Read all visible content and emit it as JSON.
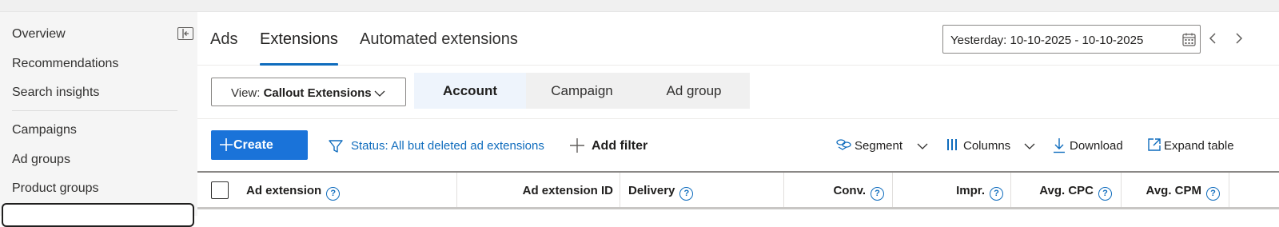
{
  "sidebar": {
    "items": [
      {
        "label": "Overview"
      },
      {
        "label": "Recommendations"
      },
      {
        "label": "Search insights"
      },
      {
        "label": "Campaigns"
      },
      {
        "label": "Ad groups"
      },
      {
        "label": "Product groups"
      }
    ],
    "collapse_icon": "collapse-panel-icon"
  },
  "tabs": [
    {
      "label": "Ads"
    },
    {
      "label": "Extensions",
      "active": true
    },
    {
      "label": "Automated extensions"
    }
  ],
  "date_range": {
    "value": "Yesterday: 10-10-2025 - 10-10-2025",
    "icon": "calendar-icon"
  },
  "view": {
    "prefix": "View:",
    "value": "Callout Extensions"
  },
  "segments": [
    {
      "label": "Account",
      "active": true
    },
    {
      "label": "Campaign"
    },
    {
      "label": "Ad group"
    }
  ],
  "toolbar": {
    "create_label": "Create",
    "filter_label": "Status: All but deleted ad extensions",
    "add_filter_label": "Add filter",
    "segment_label": "Segment",
    "columns_label": "Columns",
    "download_label": "Download",
    "expand_label": "Expand table"
  },
  "table": {
    "columns": [
      {
        "label": "Ad extension"
      },
      {
        "label": "Ad extension ID"
      },
      {
        "label": "Delivery"
      },
      {
        "label": "Conv."
      },
      {
        "label": "Impr."
      },
      {
        "label": "Avg. CPC"
      },
      {
        "label": "Avg. CPM"
      }
    ],
    "help_glyph": "?"
  },
  "colors": {
    "accent": "#0f6cbd",
    "create_button": "#1a73d9",
    "active_segment": "#eef4fc"
  }
}
